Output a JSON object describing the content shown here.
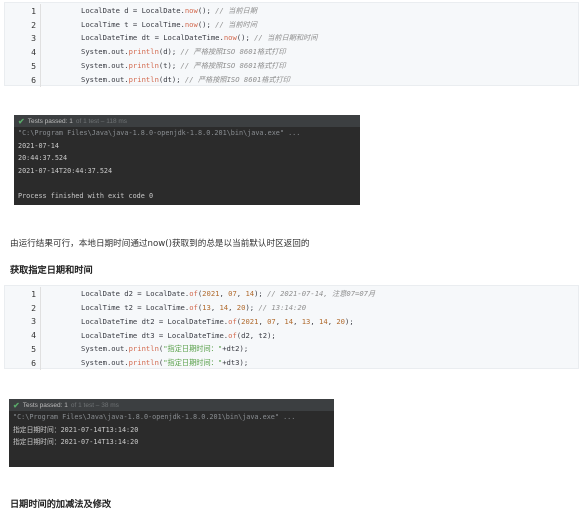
{
  "code_block_1": {
    "lines": [
      {
        "num": "1",
        "parts": [
          [
            "",
            "LocalDate d = LocalDate."
          ],
          [
            "fn",
            "now"
          ],
          [
            "",
            "(); "
          ],
          [
            "cm",
            "// 当前日期"
          ]
        ]
      },
      {
        "num": "2",
        "parts": [
          [
            "",
            "LocalTime t = LocalTime."
          ],
          [
            "fn",
            "now"
          ],
          [
            "",
            "(); "
          ],
          [
            "cm",
            "// 当前时间"
          ]
        ]
      },
      {
        "num": "3",
        "parts": [
          [
            "",
            "LocalDateTime dt = LocalDateTime."
          ],
          [
            "fn",
            "now"
          ],
          [
            "",
            "(); "
          ],
          [
            "cm",
            "// 当前日期和时间"
          ]
        ]
      },
      {
        "num": "4",
        "parts": [
          [
            "",
            "System.out."
          ],
          [
            "fn",
            "println"
          ],
          [
            "",
            "(d); "
          ],
          [
            "cm",
            "// 严格按照ISO 8601格式打印"
          ]
        ]
      },
      {
        "num": "5",
        "parts": [
          [
            "",
            "System.out."
          ],
          [
            "fn",
            "println"
          ],
          [
            "",
            "(t); "
          ],
          [
            "cm",
            "// 严格按照ISO 8601格式打印"
          ]
        ]
      },
      {
        "num": "6",
        "parts": [
          [
            "",
            "System.out."
          ],
          [
            "fn",
            "println"
          ],
          [
            "",
            "(dt); "
          ],
          [
            "cm",
            "// 严格按照ISO 8601格式打印"
          ]
        ]
      }
    ]
  },
  "console_1": {
    "tab_label": "Tests passed: 1",
    "tab_detail": "of 1 test – 118 ms",
    "command": "\"C:\\Program Files\\Java\\java-1.8.0-openjdk-1.8.0.201\\bin\\java.exe\" ...",
    "output": [
      "2021-07-14",
      "20:44:37.524",
      "2021-07-14T20:44:37.524",
      "",
      "Process finished with exit code 0"
    ]
  },
  "paragraph_1": "由运行结果可行，本地日期时间通过now()获取到的总是以当前默认时区返回的",
  "heading_1": "获取指定日期和时间",
  "code_block_2": {
    "lines": [
      {
        "num": "1",
        "parts": [
          [
            "",
            "LocalDate d2 = LocalDate."
          ],
          [
            "fn",
            "of"
          ],
          [
            "",
            "("
          ],
          [
            "num",
            "2021"
          ],
          [
            "",
            ", "
          ],
          [
            "num",
            "07"
          ],
          [
            "",
            ", "
          ],
          [
            "num",
            "14"
          ],
          [
            "",
            "); "
          ],
          [
            "cm",
            "// 2021-07-14, 注意07=07月"
          ]
        ]
      },
      {
        "num": "2",
        "parts": [
          [
            "",
            "LocalTime t2 = LocalTime."
          ],
          [
            "fn",
            "of"
          ],
          [
            "",
            "("
          ],
          [
            "num",
            "13"
          ],
          [
            "",
            ", "
          ],
          [
            "num",
            "14"
          ],
          [
            "",
            ", "
          ],
          [
            "num",
            "20"
          ],
          [
            "",
            "); "
          ],
          [
            "cm",
            "// 13:14:20"
          ]
        ]
      },
      {
        "num": "3",
        "parts": [
          [
            "",
            "LocalDateTime dt2 = LocalDateTime."
          ],
          [
            "fn",
            "of"
          ],
          [
            "",
            "("
          ],
          [
            "num",
            "2021"
          ],
          [
            "",
            ", "
          ],
          [
            "num",
            "07"
          ],
          [
            "",
            ", "
          ],
          [
            "num",
            "14"
          ],
          [
            "",
            ", "
          ],
          [
            "num",
            "13"
          ],
          [
            "",
            ", "
          ],
          [
            "num",
            "14"
          ],
          [
            "",
            ", "
          ],
          [
            "num",
            "20"
          ],
          [
            "",
            ");"
          ]
        ]
      },
      {
        "num": "4",
        "parts": [
          [
            "",
            "LocalDateTime dt3 = LocalDateTime."
          ],
          [
            "fn",
            "of"
          ],
          [
            "",
            "(d2, t2);"
          ]
        ]
      },
      {
        "num": "5",
        "parts": [
          [
            "",
            "System.out."
          ],
          [
            "fn",
            "println"
          ],
          [
            "",
            "("
          ],
          [
            "str",
            "\"指定日期时间：\""
          ],
          [
            "",
            "+dt2);"
          ]
        ]
      },
      {
        "num": "6",
        "parts": [
          [
            "",
            "System.out."
          ],
          [
            "fn",
            "println"
          ],
          [
            "",
            "("
          ],
          [
            "str",
            "\"指定日期时间：\""
          ],
          [
            "",
            "+dt3);"
          ]
        ]
      }
    ]
  },
  "console_2": {
    "tab_label": "Tests passed: 1",
    "tab_detail": "of 1 test – 38 ms",
    "command": "\"C:\\Program Files\\Java\\java-1.8.0-openjdk-1.8.0.201\\bin\\java.exe\" ...",
    "output": [
      "指定日期时间：2021-07-14T13:14:20",
      "指定日期时间：2021-07-14T13:14:20"
    ]
  },
  "heading_2": "日期时间的加减法及修改"
}
